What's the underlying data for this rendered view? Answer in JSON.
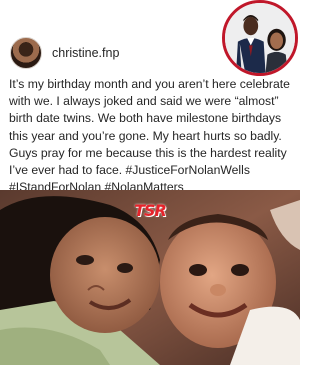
{
  "post": {
    "username": "christine.fnp",
    "caption": "It’s my birthday month and you aren’t here celebrate with we. I always joked and said we were “almost” birth date twins. We both have milestone birthdays this year and you’re gone. My heart hurts so badly. Guys pray for me because this is the hardest reality I’ve ever had to face. #JusticeForNolanWells #IStandForNolan #NolanMatters"
  },
  "watermark": {
    "text": "TSR",
    "color": "#e6242b"
  },
  "colors": {
    "inset_border": "#c0172a",
    "text": "#262626"
  }
}
